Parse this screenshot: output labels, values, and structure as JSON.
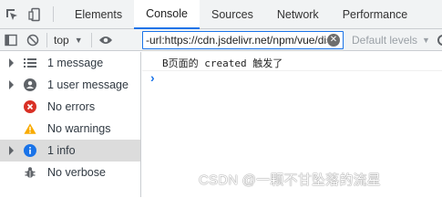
{
  "tabs": [
    {
      "label": "Elements"
    },
    {
      "label": "Console"
    },
    {
      "label": "Sources"
    },
    {
      "label": "Network"
    },
    {
      "label": "Performance"
    }
  ],
  "toolbar": {
    "context_label": "top",
    "filter_value": "-url:https://cdn.jsdelivr.net/npm/vue/dist/vue.js",
    "levels_label": "Default levels"
  },
  "sidebar": {
    "items": [
      {
        "label": "1 message",
        "icon": "list-icon",
        "expandable": true
      },
      {
        "label": "1 user message",
        "icon": "user-icon",
        "expandable": true
      },
      {
        "label": "No errors",
        "icon": "error-icon",
        "expandable": false
      },
      {
        "label": "No warnings",
        "icon": "warning-icon",
        "expandable": false
      },
      {
        "label": "1 info",
        "icon": "info-icon",
        "expandable": true,
        "selected": true
      },
      {
        "label": "No verbose",
        "icon": "bug-icon",
        "expandable": false
      }
    ]
  },
  "console": {
    "log_text": "B页面的 created 触发了",
    "prompt": "›"
  },
  "watermark": "CSDN @一颗不甘坠落的流星",
  "colors": {
    "accent": "#1a73e8",
    "error": "#d93025",
    "warning": "#f9ab00",
    "info": "#1a73e8"
  }
}
